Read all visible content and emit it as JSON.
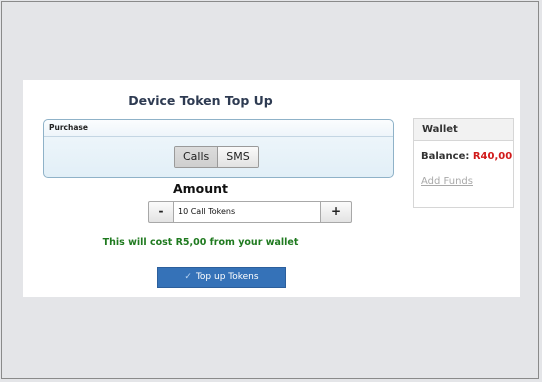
{
  "page": {
    "title": "Device Token Top Up"
  },
  "purchase": {
    "heading": "Purchase",
    "options": [
      "Calls",
      "SMS"
    ],
    "selected": "Calls"
  },
  "amount": {
    "label": "Amount",
    "minus_label": "-",
    "plus_label": "+",
    "value": "10 Call Tokens"
  },
  "cost_text": "This will cost R5,00 from your wallet",
  "topup_button": {
    "icon": "check-icon",
    "label": "Top up Tokens"
  },
  "wallet": {
    "heading": "Wallet",
    "balance_label": "Balance:",
    "balance_value": "R40,00",
    "add_funds_label": "Add Funds"
  },
  "colors": {
    "cost_green": "#1f7a1f",
    "balance_red": "#d11a1a",
    "button_blue": "#3572b8"
  }
}
